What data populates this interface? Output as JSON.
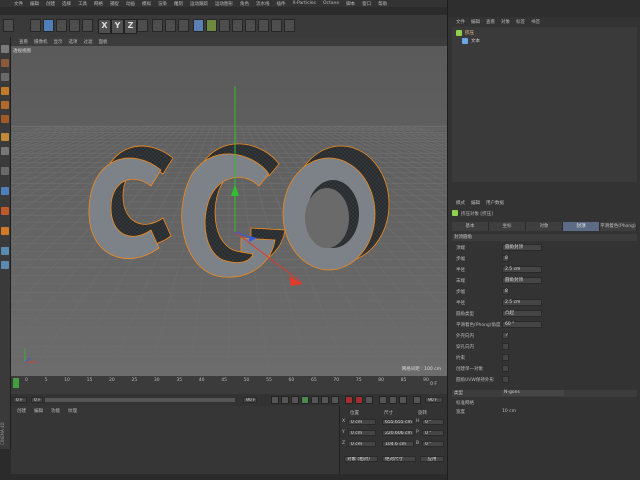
{
  "app": {
    "brand": "CINEMA 4D"
  },
  "menubar": {
    "items": [
      "文件",
      "编辑",
      "创建",
      "选择",
      "工具",
      "网格",
      "捕捉",
      "动画",
      "模拟",
      "渲染",
      "雕刻",
      "运动跟踪",
      "运动图形",
      "角色",
      "流水线",
      "插件",
      "X-Particles",
      "Octane",
      "脚本",
      "窗口",
      "帮助"
    ]
  },
  "toolbar": {
    "x_label": "X",
    "y_label": "Y",
    "z_label": "Z"
  },
  "viewport": {
    "menu": [
      "查看",
      "摄像机",
      "显示",
      "选项",
      "过滤",
      "面板"
    ],
    "label": "透视视图",
    "grid_info": "网格间距 : 100 cm",
    "text3d": "CGO"
  },
  "timeline": {
    "ticks": [
      "0",
      "5",
      "10",
      "15",
      "20",
      "25",
      "30",
      "35",
      "40",
      "45",
      "50",
      "55",
      "60",
      "65",
      "70",
      "75",
      "80",
      "85",
      "90"
    ],
    "frame_current": "0 F",
    "frame_start": "0 F",
    "frame_end": "90 F",
    "frame_end2": "90 F",
    "frame_indicator": "0 F"
  },
  "material": {
    "menu": [
      "创建",
      "编辑",
      "功能",
      "纹理"
    ]
  },
  "coords": {
    "header_pos": "位置",
    "header_size": "尺寸",
    "header_rot": "旋转",
    "rows": [
      {
        "axis": "X",
        "pos": "0 cm",
        "size": "655.655 cm",
        "rot_axis": "H",
        "rot": "0 °"
      },
      {
        "axis": "Y",
        "pos": "0 cm",
        "size": "220.606 cm",
        "rot_axis": "P",
        "rot": "0 °"
      },
      {
        "axis": "Z",
        "pos": "0 cm",
        "size": "104.6 cm",
        "rot_axis": "B",
        "rot": "0 °"
      }
    ],
    "mode_select": "对象 (相对)",
    "size_select": "绝对尺寸",
    "apply_label": "应用"
  },
  "objects": {
    "menu": [
      "文件",
      "编辑",
      "查看",
      "对象",
      "标签",
      "书签"
    ],
    "items": [
      {
        "name": "挤压",
        "color": "#8fd14f"
      },
      {
        "name": "文本",
        "color": "#6aa6e8"
      }
    ]
  },
  "attributes": {
    "menu": [
      "模式",
      "编辑",
      "用户数据"
    ],
    "object_title": "挤压对象 [挤压]",
    "tabs": [
      "基本",
      "坐标",
      "对象",
      "封顶",
      "平滑着色(Phong)"
    ],
    "active_tab": 3,
    "section_cap": "封顶圆角",
    "rows": [
      {
        "label": "顶端",
        "value": "圆角封顶"
      },
      {
        "label": "步幅",
        "value": "8"
      },
      {
        "label": "半径",
        "value": "2.5 cm"
      },
      {
        "label": "末端",
        "value": "圆角封顶"
      },
      {
        "label": "步幅",
        "value": "8"
      },
      {
        "label": "半径",
        "value": "2.5 cm"
      },
      {
        "label": "圆角类型",
        "value": "凸起"
      },
      {
        "label": "平滑着色(Phong)角度",
        "value": "60 °"
      },
      {
        "label": "外壳向内",
        "value": "✓"
      },
      {
        "label": "穿孔向内",
        "value": ""
      },
      {
        "label": "约束",
        "value": ""
      },
      {
        "label": "创建单一对象",
        "value": ""
      },
      {
        "label": "圆角UVW保持外形",
        "value": ""
      }
    ],
    "type_label": "类型",
    "type_value": "N-gons",
    "sub_label1": "标准网格",
    "sub_label2": "宽度",
    "sub_value2": "10 cm"
  },
  "colors": {
    "accent": "#5d6c86",
    "selection": "#f08a1c",
    "viewport_bg": "#5e5e5e"
  }
}
